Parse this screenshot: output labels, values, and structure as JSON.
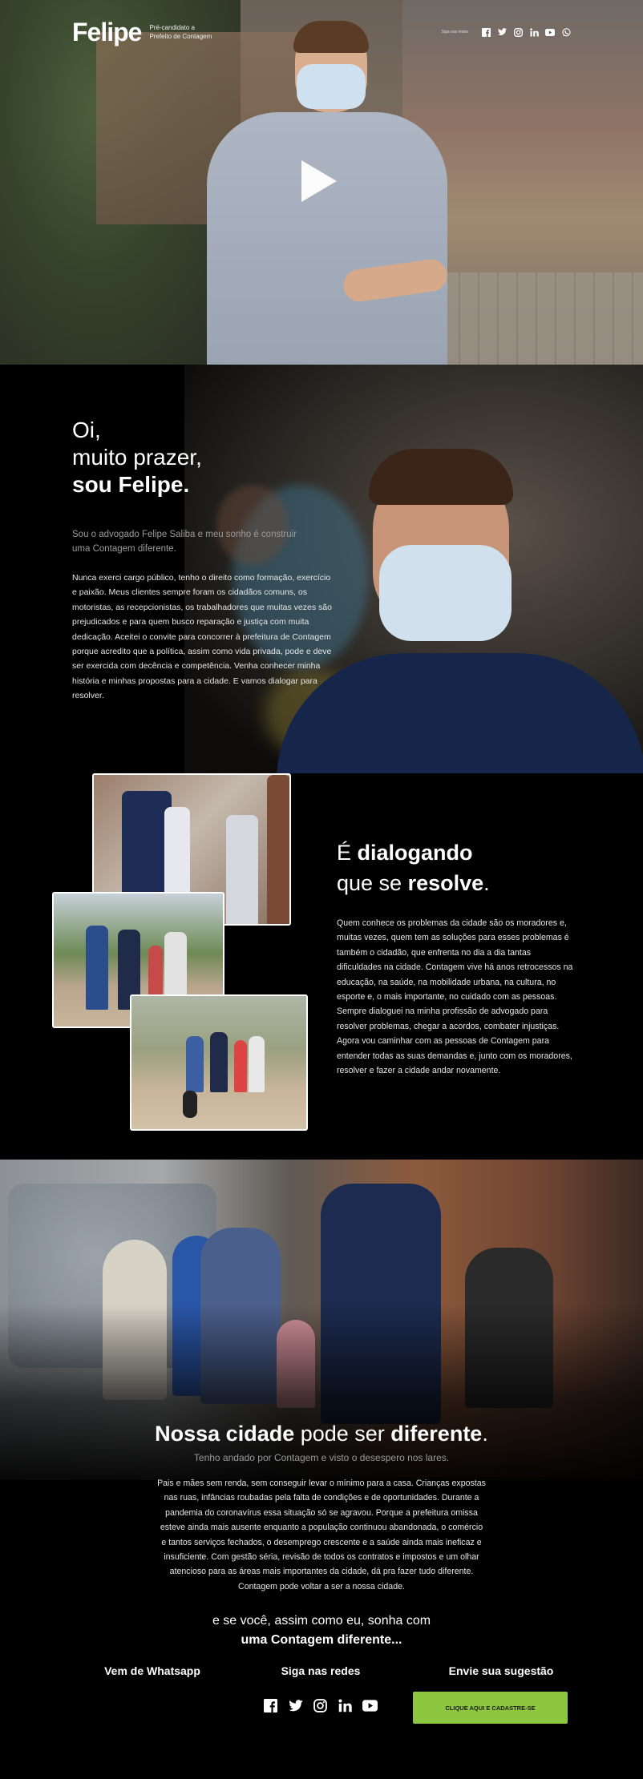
{
  "header": {
    "logo": "Felipe",
    "logo_subtitle_line1": "Pré-candidato a",
    "logo_subtitle_line2": "Prefeito de Contagem",
    "follow_label": "Siga nas redes",
    "social_icons": [
      "facebook-icon",
      "twitter-icon",
      "instagram-icon",
      "linkedin-icon",
      "youtube-icon",
      "whatsapp-icon"
    ]
  },
  "hero": {
    "play_icon": "play-icon"
  },
  "intro": {
    "greet_line1": "Oi,",
    "greet_line2": "muito prazer,",
    "greet_line3": "sou Felipe.",
    "lead": "Sou o advogado Felipe Saliba e meu sonho é construir uma Contagem diferente.",
    "body": "Nunca exerci cargo público, tenho o direito como formação, exercício e paixão. Meus clientes sempre foram os cidadãos comuns, os motoristas, as recepcionistas, os trabalhadores que muitas vezes são prejudicados e para quem busco reparação e justiça com muita dedicação. Aceitei o convite para concorrer à prefeitura de Contagem porque acredito que a política, assim como vida privada, pode e deve ser exercida com decência e competência. Venha conhecer minha história e minhas propostas para a cidade. E vamos dialogar para resolver."
  },
  "dialog": {
    "title_part1": "É ",
    "title_bold1": "dialogando",
    "title_part2": "que se ",
    "title_bold2": "resolve",
    "title_part3": ".",
    "body": "Quem conhece os problemas da cidade são os moradores e, muitas vezes, quem tem as soluções para esses problemas é também o cidadão, que enfrenta no dia a dia tantas dificuldades na cidade. Contagem vive há anos retrocessos na educação, na saúde, na mobilidade urbana, na cultura, no esporte e, o mais importante, no cuidado com as pessoas. Sempre dialoguei na minha profissão de advogado para resolver problemas, chegar a acordos, combater injustiças. Agora vou caminhar com as pessoas de Contagem para entender todas as suas demandas e, junto com os moradores, resolver e fazer a cidade andar novamente."
  },
  "city": {
    "title_bold1": "Nossa cidade",
    "title_part": " pode ser ",
    "title_bold2": "diferente",
    "title_end": ".",
    "lead": "Tenho andado por Contagem e visto o desespero nos lares.",
    "body": "Pais e mães sem renda, sem conseguir levar o mínimo para a casa. Crianças expostas nas ruas, infâncias roubadas pela falta de condições e de oportunidades. Durante a pandemia do coronavírus essa situação só se agravou. Porque a prefeitura omissa esteve ainda mais ausente enquanto a população continuou abandonada, o comércio e tantos serviços fechados, o desemprego crescente e a saúde ainda mais ineficaz e insuficiente. Com gestão séria, revisão de todos os contratos e impostos e um olhar atencioso para as áreas mais importantes da cidade, dá pra fazer tudo diferente. Contagem pode voltar a ser a nossa cidade.",
    "close_line1": "e se você, assim como eu, sonha com",
    "close_line2": "uma Contagem diferente..."
  },
  "footer": {
    "col1_title": "Vem de Whatsapp",
    "col2_title": "Siga nas redes",
    "col3_title": "Envie sua sugestão",
    "social_icons": [
      "facebook-icon",
      "twitter-icon",
      "instagram-icon",
      "linkedin-icon",
      "youtube-icon"
    ],
    "cta_label": "CLIQUE AQUI E CADASTRE-SE",
    "cta_color": "#8dc63f"
  }
}
